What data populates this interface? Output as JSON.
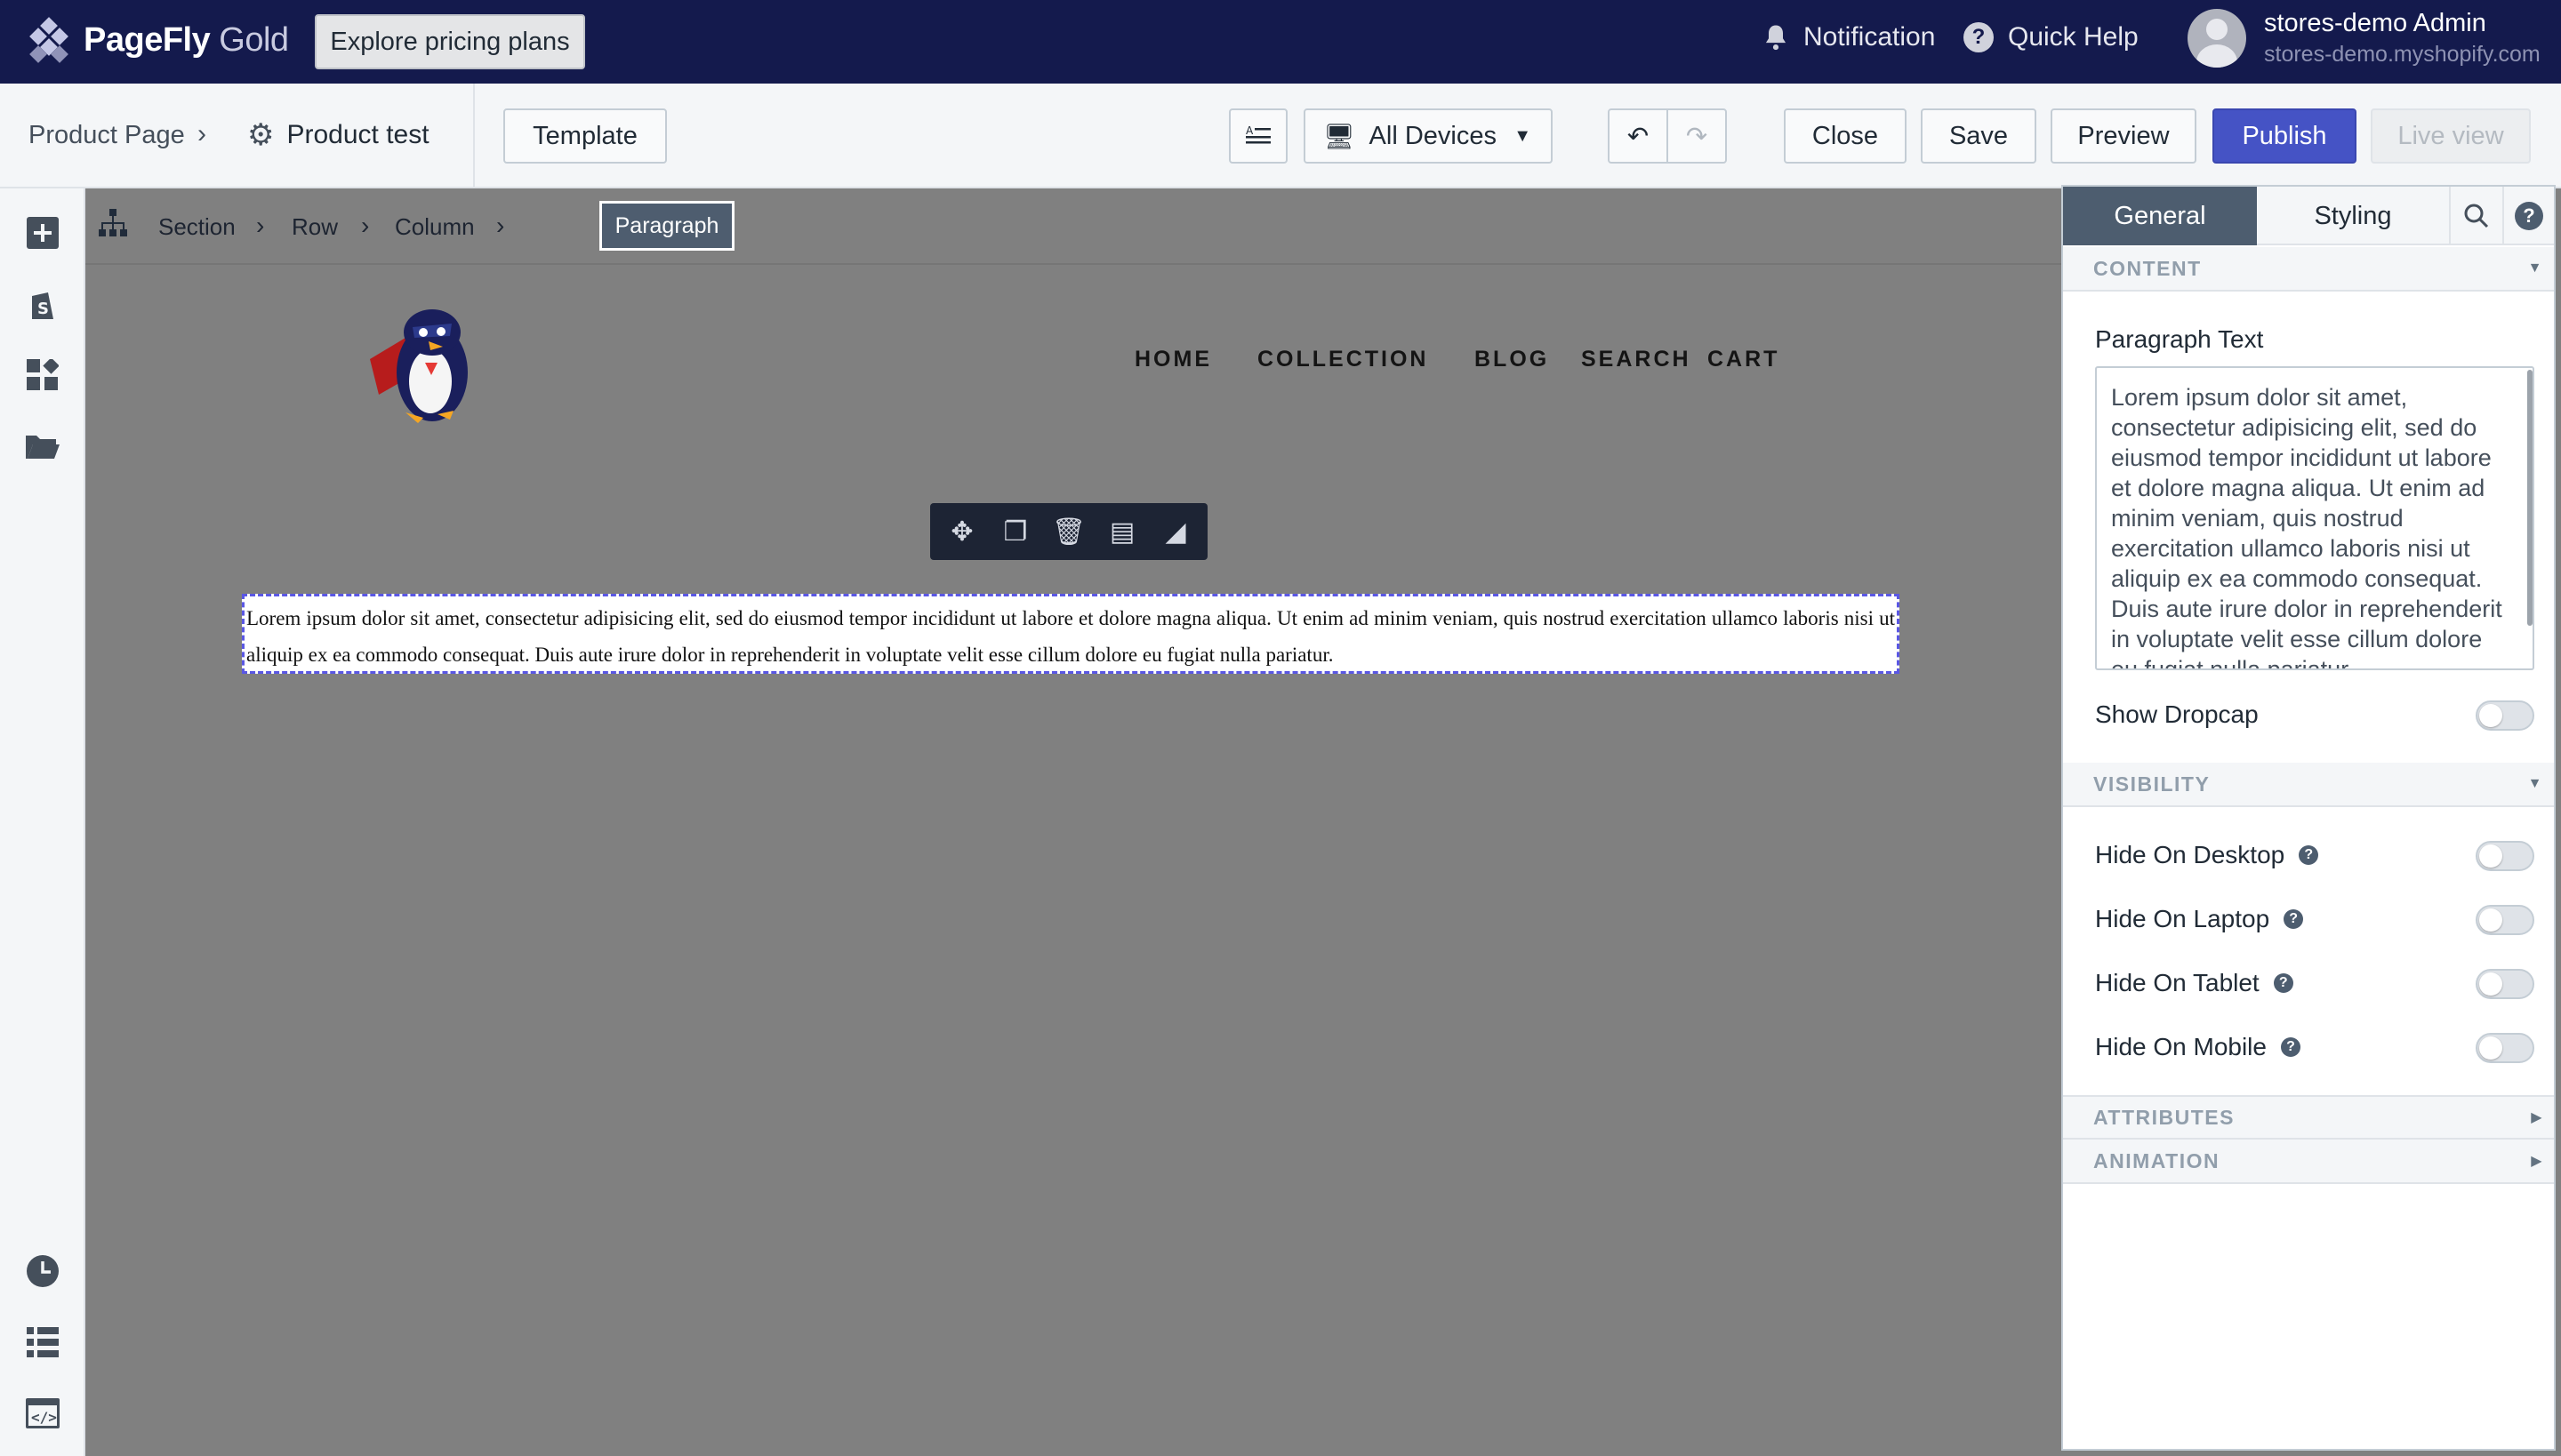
{
  "topbar": {
    "brand_main": "PageFly",
    "brand_tier": " Gold",
    "explore_label": "Explore pricing plans",
    "notification_label": "Notification",
    "help_label": "Quick Help",
    "user_name": "stores-demo Admin",
    "user_domain": "stores-demo.myshopify.com"
  },
  "toolbar": {
    "crumb_parent": "Product Page",
    "crumb_current": "Product test",
    "template_label": "Template",
    "devices_label": "All Devices",
    "close_label": "Close",
    "save_label": "Save",
    "preview_label": "Preview",
    "publish_label": "Publish",
    "live_label": "Live view"
  },
  "breadcrumb": {
    "items": [
      "Section",
      "Row",
      "Column"
    ],
    "active": "Paragraph"
  },
  "store": {
    "nav": [
      "HOME",
      "COLLECTION",
      "BLOG",
      "SEARCH",
      "CART"
    ]
  },
  "paragraph_text": "Lorem ipsum dolor sit amet, consectetur adipisicing elit, sed do eiusmod tempor incididunt ut labore et dolore magna aliqua. Ut enim ad minim veniam, quis nostrud exercitation ullamco laboris nisi ut aliquip ex ea commodo consequat. Duis aute irure dolor in reprehenderit in voluptate velit esse cillum dolore eu fugiat nulla pariatur.",
  "panel": {
    "tab_general": "General",
    "tab_styling": "Styling",
    "content_heading": "CONTENT",
    "paragraph_label": "Paragraph Text",
    "textarea_value": "Lorem ipsum dolor sit amet, consectetur adipisicing elit, sed do eiusmod tempor incididunt ut labore et dolore magna aliqua. Ut enim ad minim veniam, quis nostrud exercitation ullamco laboris nisi ut aliquip ex ea commodo consequat. Duis aute irure dolor in reprehenderit in voluptate velit esse cillum dolore eu fugiat nulla pariatur.",
    "dropcap_label": "Show Dropcap",
    "visibility_heading": "VISIBILITY",
    "hide_desktop": "Hide On Desktop",
    "hide_laptop": "Hide On Laptop",
    "hide_tablet": "Hide On Tablet",
    "hide_mobile": "Hide On Mobile",
    "attributes_heading": "ATTRIBUTES",
    "animation_heading": "ANIMATION"
  },
  "colors": {
    "topbar_bg": "#141a4d",
    "publish_bg": "#4553c5",
    "active_tab_bg": "#4d5d6f",
    "selection_border": "#5a57e4"
  }
}
